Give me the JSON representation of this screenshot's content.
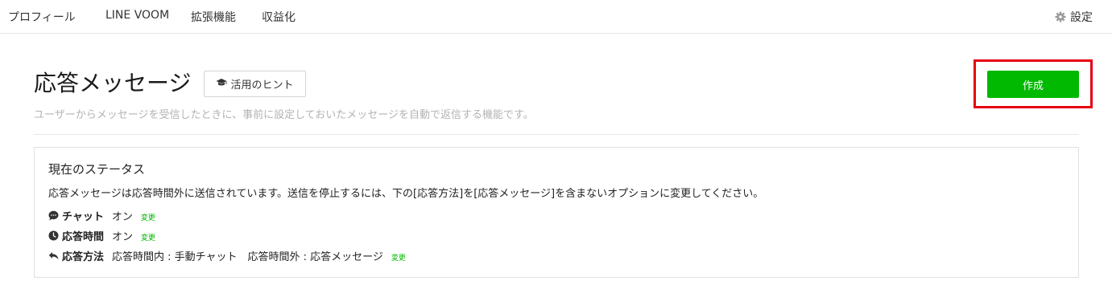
{
  "nav": {
    "items": [
      {
        "label": "プロフィール"
      },
      {
        "label": "LINE VOOM"
      },
      {
        "label": "拡張機能"
      },
      {
        "label": "収益化"
      }
    ],
    "settings_label": "設定",
    "settings_icon": "gear-icon"
  },
  "header": {
    "title": "応答メッセージ",
    "hint_button_label": "活用のヒント",
    "hint_icon": "graduation-cap-icon",
    "subtitle": "ユーザーからメッセージを受信したときに、事前に設定しておいたメッセージを自動で返信する機能です。",
    "create_button_label": "作成"
  },
  "status": {
    "heading": "現在のステータス",
    "description": "応答メッセージは応答時間外に送信されています。送信を停止するには、下の[応答方法]を[応答メッセージ]を含まないオプションに変更してください。",
    "rows": [
      {
        "icon": "chat-bubble-icon",
        "label": "チャット",
        "value": "オン",
        "link": "変更"
      },
      {
        "icon": "clock-icon",
        "label": "応答時間",
        "value": "オン",
        "link": "変更"
      },
      {
        "icon": "reply-icon",
        "label": "応答方法",
        "value": "応答時間内 : 手動チャット　応答時間外 : 応答メッセージ",
        "link": "変更"
      }
    ]
  },
  "colors": {
    "accent_green": "#00b900",
    "highlight_red": "#e60012"
  }
}
